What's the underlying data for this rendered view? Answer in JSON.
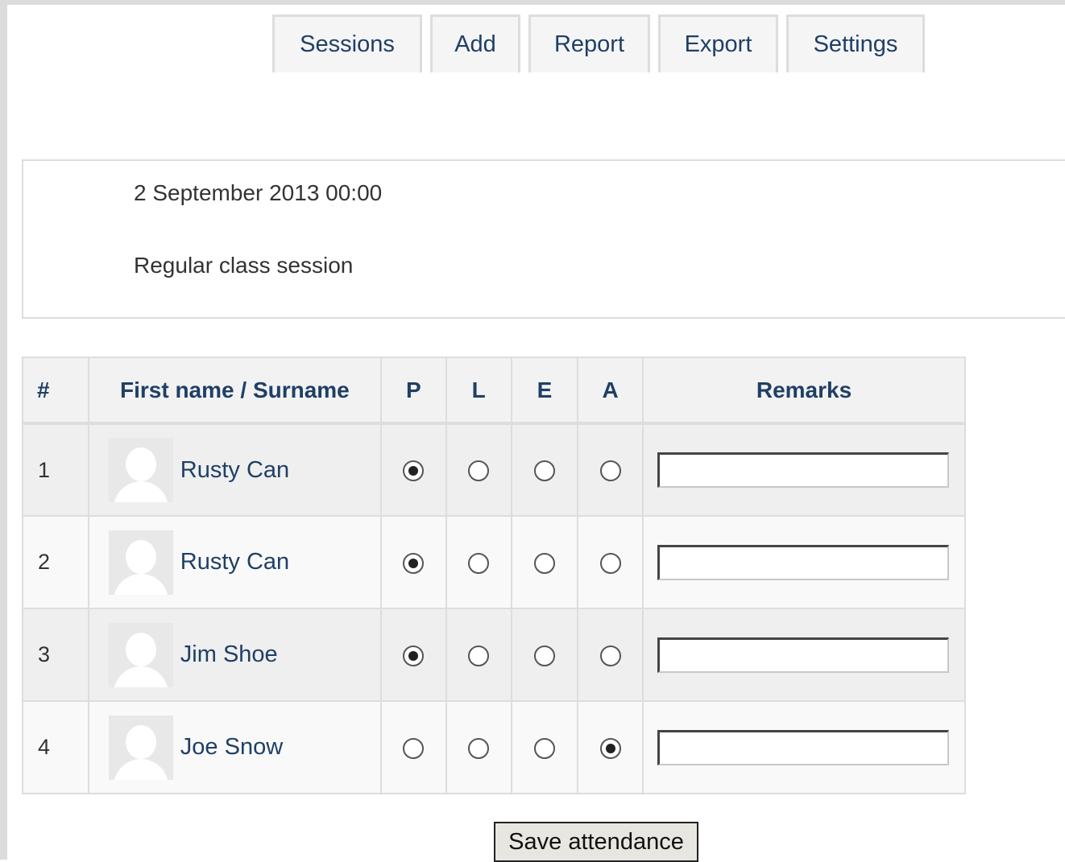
{
  "tabs": [
    {
      "label": "Sessions"
    },
    {
      "label": "Add"
    },
    {
      "label": "Report"
    },
    {
      "label": "Export"
    },
    {
      "label": "Settings"
    }
  ],
  "session": {
    "date": "2 September 2013 00:00",
    "description": "Regular class session"
  },
  "table": {
    "headers": {
      "num": "#",
      "name": "First name / Surname",
      "p": "P",
      "l": "L",
      "e": "E",
      "a": "A",
      "remarks": "Remarks"
    },
    "rows": [
      {
        "num": "1",
        "name": "Rusty Can",
        "status": "P",
        "remarks": ""
      },
      {
        "num": "2",
        "name": "Rusty Can",
        "status": "P",
        "remarks": ""
      },
      {
        "num": "3",
        "name": "Jim Shoe",
        "status": "P",
        "remarks": ""
      },
      {
        "num": "4",
        "name": "Joe Snow",
        "status": "A",
        "remarks": ""
      }
    ]
  },
  "save_button": {
    "label": "Save attendance"
  }
}
